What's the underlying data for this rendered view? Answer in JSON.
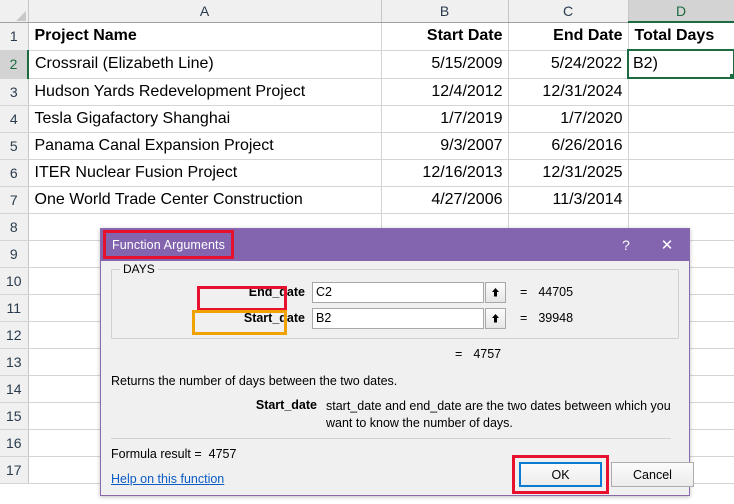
{
  "spreadsheet": {
    "columns": [
      "A",
      "B",
      "C",
      "D"
    ],
    "active_column": "D",
    "active_row": "2",
    "row_numbers": [
      "1",
      "2",
      "3",
      "4",
      "5",
      "6",
      "7",
      "8",
      "9",
      "10",
      "11",
      "12",
      "13",
      "14",
      "15",
      "16",
      "17"
    ],
    "headers": {
      "a": "Project Name",
      "b": "Start Date",
      "c": "End Date",
      "d": "Total Days"
    },
    "rows": [
      {
        "num": "2",
        "name": "Crossrail (Elizabeth Line)",
        "start": "5/15/2009",
        "end": "5/24/2022",
        "total": "B2)"
      },
      {
        "num": "3",
        "name": "Hudson Yards Redevelopment Project",
        "start": "12/4/2012",
        "end": "12/31/2024",
        "total": ""
      },
      {
        "num": "4",
        "name": "Tesla Gigafactory Shanghai",
        "start": "1/7/2019",
        "end": "1/7/2020",
        "total": ""
      },
      {
        "num": "5",
        "name": "Panama Canal Expansion Project",
        "start": "9/3/2007",
        "end": "6/26/2016",
        "total": ""
      },
      {
        "num": "6",
        "name": "ITER Nuclear Fusion Project",
        "start": "12/16/2013",
        "end": "12/31/2025",
        "total": ""
      },
      {
        "num": "7",
        "name": "One World Trade Center Construction",
        "start": "4/27/2006",
        "end": "11/3/2014",
        "total": ""
      }
    ]
  },
  "dialog": {
    "title": "Function Arguments",
    "help_button": "?",
    "close_button": "✕",
    "function_name": "DAYS",
    "arguments": [
      {
        "label": "End_date",
        "value": "C2",
        "equals": "=",
        "result": "44705",
        "collapse_icon": "collapse-dialog-icon"
      },
      {
        "label": "Start_date",
        "value": "B2",
        "equals": "=",
        "result": "39948",
        "collapse_icon": "collapse-dialog-icon"
      }
    ],
    "total_equals": "=",
    "total_value": "4757",
    "description": "Returns the number of days between the two dates.",
    "arg_help_term": "Start_date",
    "arg_help_text": "start_date and end_date are the two dates between which you want to know the number of days.",
    "formula_result_label": "Formula result  =",
    "formula_result_value": "4757",
    "help_link": "Help on this function",
    "ok_button": "OK",
    "cancel_button": "Cancel"
  },
  "colors": {
    "title_bar": "#8265ae",
    "highlight_red": "#e8112d",
    "highlight_orange": "#f0a202",
    "focus_blue": "#0a7bd4",
    "selection_green": "#1e6b41",
    "link_blue": "#0b5cc4"
  }
}
